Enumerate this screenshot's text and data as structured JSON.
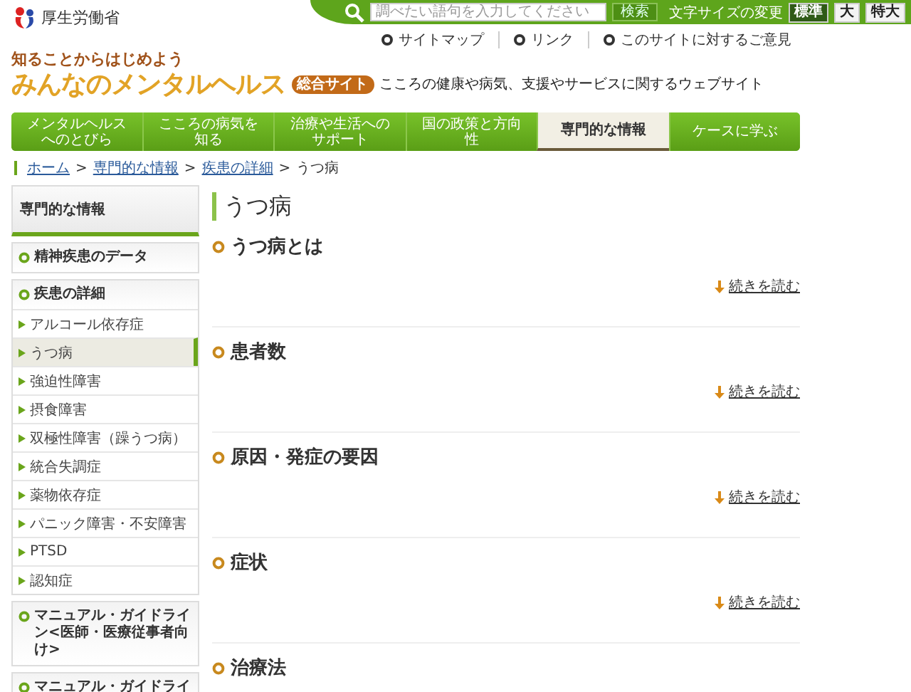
{
  "header": {
    "ministry_name": "厚生労働省",
    "search": {
      "placeholder": "調べたい語句を入力してください",
      "button": "検索"
    },
    "font_size": {
      "label": "文字サイズの変更",
      "options": [
        {
          "label": "標準",
          "selected": true
        },
        {
          "label": "大",
          "selected": false
        },
        {
          "label": "特大",
          "selected": false
        }
      ]
    },
    "utility_links": [
      "サイトマップ",
      "リンク",
      "このサイトに対するご意見"
    ],
    "tagline": "知ることからはじめよう",
    "site_title": "みんなのメンタルヘルス",
    "badge": "総合サイト",
    "description": "こころの健康や病気、支援やサービスに関するウェブサイト"
  },
  "nav": [
    {
      "label": "メンタルヘルスへのとびら",
      "selected": false
    },
    {
      "label": "こころの病気を知る",
      "selected": false
    },
    {
      "label": "治療や生活へのサポート",
      "selected": false
    },
    {
      "label": "国の政策と方向性",
      "selected": false
    },
    {
      "label": "専門的な情報",
      "selected": true
    },
    {
      "label": "ケースに学ぶ",
      "selected": false
    }
  ],
  "breadcrumb": {
    "links": [
      {
        "label": "ホーム",
        "separator": ">"
      },
      {
        "label": "専門的な情報",
        "separator": ">"
      },
      {
        "label": "疾患の詳細",
        "separator": ">"
      }
    ],
    "current": "うつ病"
  },
  "sidebar": {
    "title": "専門的な情報",
    "items": [
      {
        "label": "精神疾患のデータ"
      },
      {
        "label": "疾患の詳細",
        "children": [
          {
            "label": "アルコール依存症",
            "selected": false
          },
          {
            "label": "うつ病",
            "selected": true
          },
          {
            "label": "強迫性障害",
            "selected": false
          },
          {
            "label": "摂食障害",
            "selected": false
          },
          {
            "label": "双極性障害（躁うつ病）",
            "selected": false
          },
          {
            "label": "統合失調症",
            "selected": false
          },
          {
            "label": "薬物依存症",
            "selected": false
          },
          {
            "label": "パニック障害・不安障害",
            "selected": false
          },
          {
            "label": "PTSD",
            "selected": false
          },
          {
            "label": "認知症",
            "selected": false
          }
        ]
      },
      {
        "label": "マニュアル・ガイドライン<医師・医療従事者向け>"
      },
      {
        "label": "マニュアル・ガイドライ"
      }
    ]
  },
  "main": {
    "title": "うつ病",
    "sections": [
      {
        "heading": "うつ病とは",
        "link": "続きを読む"
      },
      {
        "heading": "患者数",
        "link": "続きを読む"
      },
      {
        "heading": "原因・発症の要因",
        "link": "続きを読む"
      },
      {
        "heading": "症状",
        "link": "続きを読む"
      },
      {
        "heading": "治療法"
      }
    ]
  }
}
